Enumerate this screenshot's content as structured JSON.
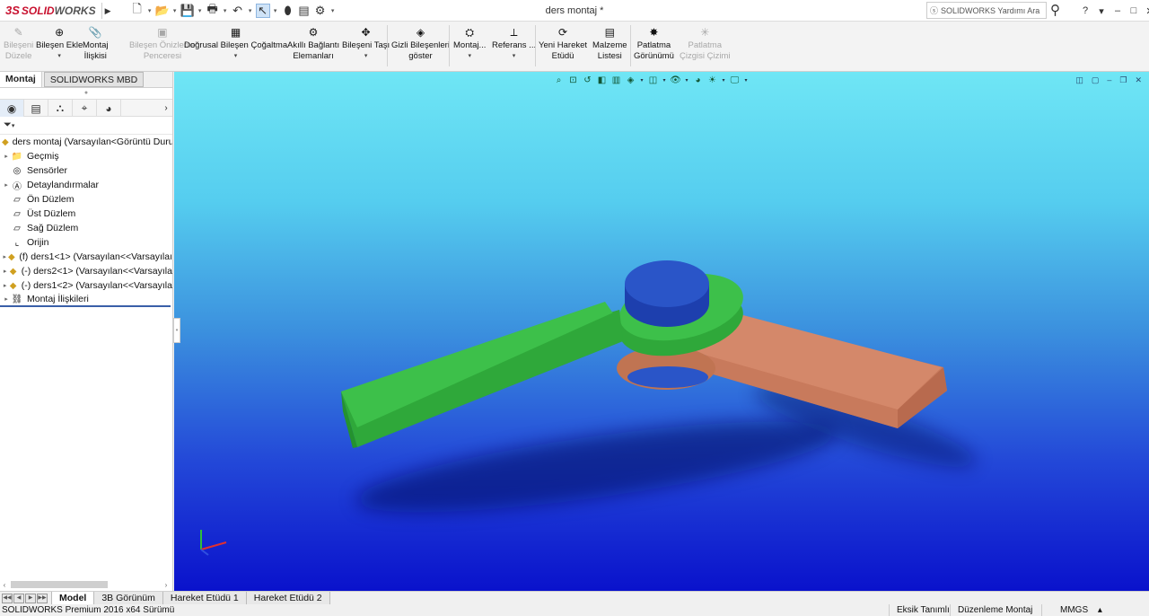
{
  "app": {
    "logo_prefix": "3S",
    "logo_solid": "SOLID",
    "logo_works": "WORKS",
    "document_title": "ders montaj *",
    "help_search_placeholder": "SOLIDWORKS Yardımı Ara",
    "help_label": "?",
    "minimize_label": "–",
    "restore_label": "□",
    "close_label": "✕"
  },
  "quick_access": [
    {
      "name": "new-icon",
      "glyph": "🗋"
    },
    {
      "name": "open-icon",
      "glyph": "📂"
    },
    {
      "name": "save-icon",
      "glyph": "💾"
    },
    {
      "name": "print-icon",
      "glyph": "🖶"
    },
    {
      "name": "undo-icon",
      "glyph": "↶"
    },
    {
      "name": "select-icon",
      "glyph": "↖"
    },
    {
      "name": "rebuild-icon",
      "glyph": "⬮"
    },
    {
      "name": "file-properties-icon",
      "glyph": "▤"
    },
    {
      "name": "options-icon",
      "glyph": "⚙"
    }
  ],
  "commands": [
    {
      "id": "edit-component",
      "line1": "Bileşeni",
      "line2": "Düzele",
      "glyph": "✎",
      "disabled": true,
      "drop": false
    },
    {
      "id": "insert-component",
      "line1": "Bileşen Ekle",
      "line2": "",
      "glyph": "⊕",
      "disabled": false,
      "drop": true
    },
    {
      "id": "mate",
      "line1": "Montaj",
      "line2": "İlişkisi",
      "glyph": "📎",
      "disabled": false,
      "drop": false
    },
    {
      "id": "component-preview",
      "line1": "Bileşen Önizleme",
      "line2": "Penceresi",
      "glyph": "▣",
      "disabled": true,
      "drop": false
    },
    {
      "id": "linear-pattern",
      "line1": "Doğrusal Bileşen Çoğaltma",
      "line2": "",
      "glyph": "▦",
      "disabled": false,
      "drop": true
    },
    {
      "id": "smart-fasteners",
      "line1": "Akıllı Bağlantı",
      "line2": "Elemanları",
      "glyph": "⚙",
      "disabled": false,
      "drop": false
    },
    {
      "id": "move-component",
      "line1": "Bileşeni Taşı",
      "line2": "",
      "glyph": "✥",
      "disabled": false,
      "drop": true
    },
    {
      "id": "show-hidden",
      "line1": "Gizli Bileşenleri",
      "line2": "göster",
      "glyph": "◈",
      "disabled": false,
      "drop": false
    },
    {
      "id": "assembly-features",
      "line1": "Montaj...",
      "line2": "",
      "glyph": "⛭",
      "disabled": false,
      "drop": true
    },
    {
      "id": "reference-geometry",
      "line1": "Referans ...",
      "line2": "",
      "glyph": "⟂",
      "disabled": false,
      "drop": true
    },
    {
      "id": "new-motion-study",
      "line1": "Yeni Hareket",
      "line2": "Etüdü",
      "glyph": "⟳",
      "disabled": false,
      "drop": false
    },
    {
      "id": "bill-of-materials",
      "line1": "Malzeme",
      "line2": "Listesi",
      "glyph": "▤",
      "disabled": false,
      "drop": false
    },
    {
      "id": "exploded-view",
      "line1": "Patlatma",
      "line2": "Görünümü",
      "glyph": "✸",
      "disabled": false,
      "drop": false
    },
    {
      "id": "explode-line-sketch",
      "line1": "Patlatma",
      "line2": "Çizgisi Çizimi",
      "glyph": "✳",
      "disabled": true,
      "drop": false
    }
  ],
  "panel_tabs": [
    {
      "label": "Montaj",
      "active": true
    },
    {
      "label": "SOLIDWORKS MBD",
      "active": false
    }
  ],
  "tree": {
    "root_label": "ders montaj  (Varsayılan<Görüntü Durur",
    "items": [
      {
        "label": "Geçmiş",
        "icon": "history-icon",
        "glyph": "📁",
        "expandable": true
      },
      {
        "label": "Sensörler",
        "icon": "sensors-icon",
        "glyph": "◎",
        "expandable": false
      },
      {
        "label": "Detaylandırmalar",
        "icon": "annotations-icon",
        "glyph": "Ⓐ",
        "expandable": true
      },
      {
        "label": "Ön Düzlem",
        "icon": "plane-icon",
        "glyph": "▱",
        "expandable": false
      },
      {
        "label": "Üst Düzlem",
        "icon": "plane-icon",
        "glyph": "▱",
        "expandable": false
      },
      {
        "label": "Sağ Düzlem",
        "icon": "plane-icon",
        "glyph": "▱",
        "expandable": false
      },
      {
        "label": "Orijin",
        "icon": "origin-icon",
        "glyph": "⌞",
        "expandable": false
      },
      {
        "label": "(f) ders1<1> (Varsayılan<<Varsayılaı",
        "icon": "part-icon",
        "glyph": "◆",
        "expandable": true
      },
      {
        "label": "(-) ders2<1> (Varsayılan<<Varsayıla",
        "icon": "part-icon",
        "glyph": "◆",
        "expandable": true
      },
      {
        "label": "(-) ders1<2> (Varsayılan<<Varsayıla",
        "icon": "part-icon",
        "glyph": "◆",
        "expandable": true
      },
      {
        "label": "Montaj İlişkileri",
        "icon": "mates-icon",
        "glyph": "⛓",
        "expandable": true
      }
    ]
  },
  "bottom_tabs": [
    {
      "label": "Model",
      "active": true
    },
    {
      "label": "3B Görünüm",
      "active": false
    },
    {
      "label": "Hareket Etüdü 1",
      "active": false
    },
    {
      "label": "Hareket Etüdü 2",
      "active": false
    }
  ],
  "status": {
    "version": "SOLIDWORKS Premium 2016 x64 Sürümü",
    "definition": "Eksik Tanımlı",
    "mode": "Düzenleme Montaj",
    "units": "MMGS",
    "units_arrow": "▴"
  },
  "colors": {
    "green_link": "#3cc04a",
    "orange_link": "#d08060",
    "blue_pin": "#2a55c8"
  }
}
